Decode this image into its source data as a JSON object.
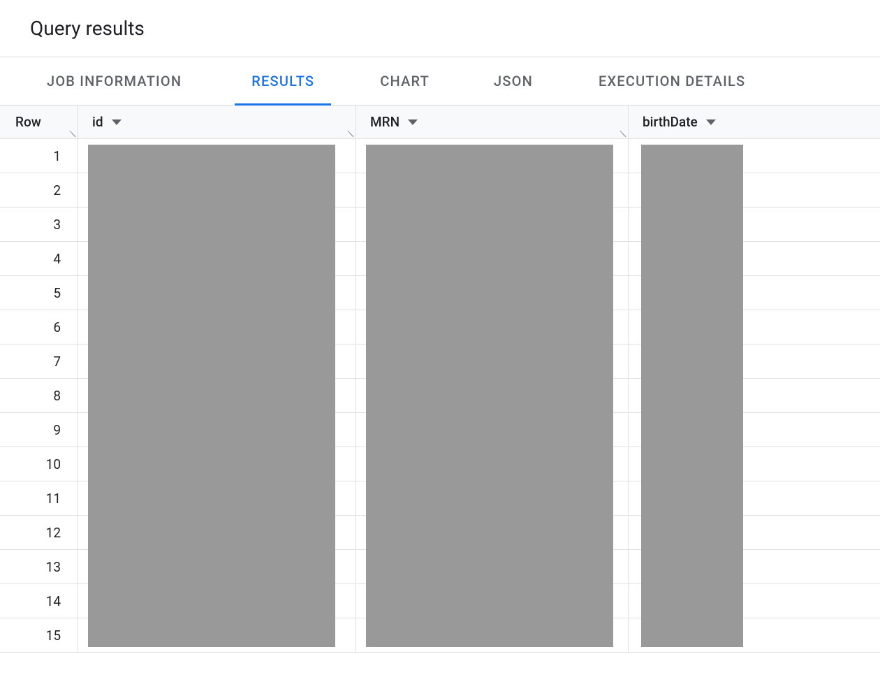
{
  "header": {
    "title": "Query results"
  },
  "tabs": [
    {
      "label": "JOB INFORMATION",
      "active": false
    },
    {
      "label": "RESULTS",
      "active": true
    },
    {
      "label": "CHART",
      "active": false
    },
    {
      "label": "JSON",
      "active": false
    },
    {
      "label": "EXECUTION DETAILS",
      "active": false
    }
  ],
  "table": {
    "columns": {
      "row": "Row",
      "id": "id",
      "mrn": "MRN",
      "birthdate": "birthDate"
    },
    "rows": [
      {
        "n": "1"
      },
      {
        "n": "2"
      },
      {
        "n": "3"
      },
      {
        "n": "4"
      },
      {
        "n": "5"
      },
      {
        "n": "6"
      },
      {
        "n": "7"
      },
      {
        "n": "8"
      },
      {
        "n": "9"
      },
      {
        "n": "10"
      },
      {
        "n": "11"
      },
      {
        "n": "12"
      },
      {
        "n": "13"
      },
      {
        "n": "14"
      },
      {
        "n": "15"
      }
    ],
    "redacted_columns": [
      "id",
      "MRN",
      "birthDate"
    ]
  }
}
